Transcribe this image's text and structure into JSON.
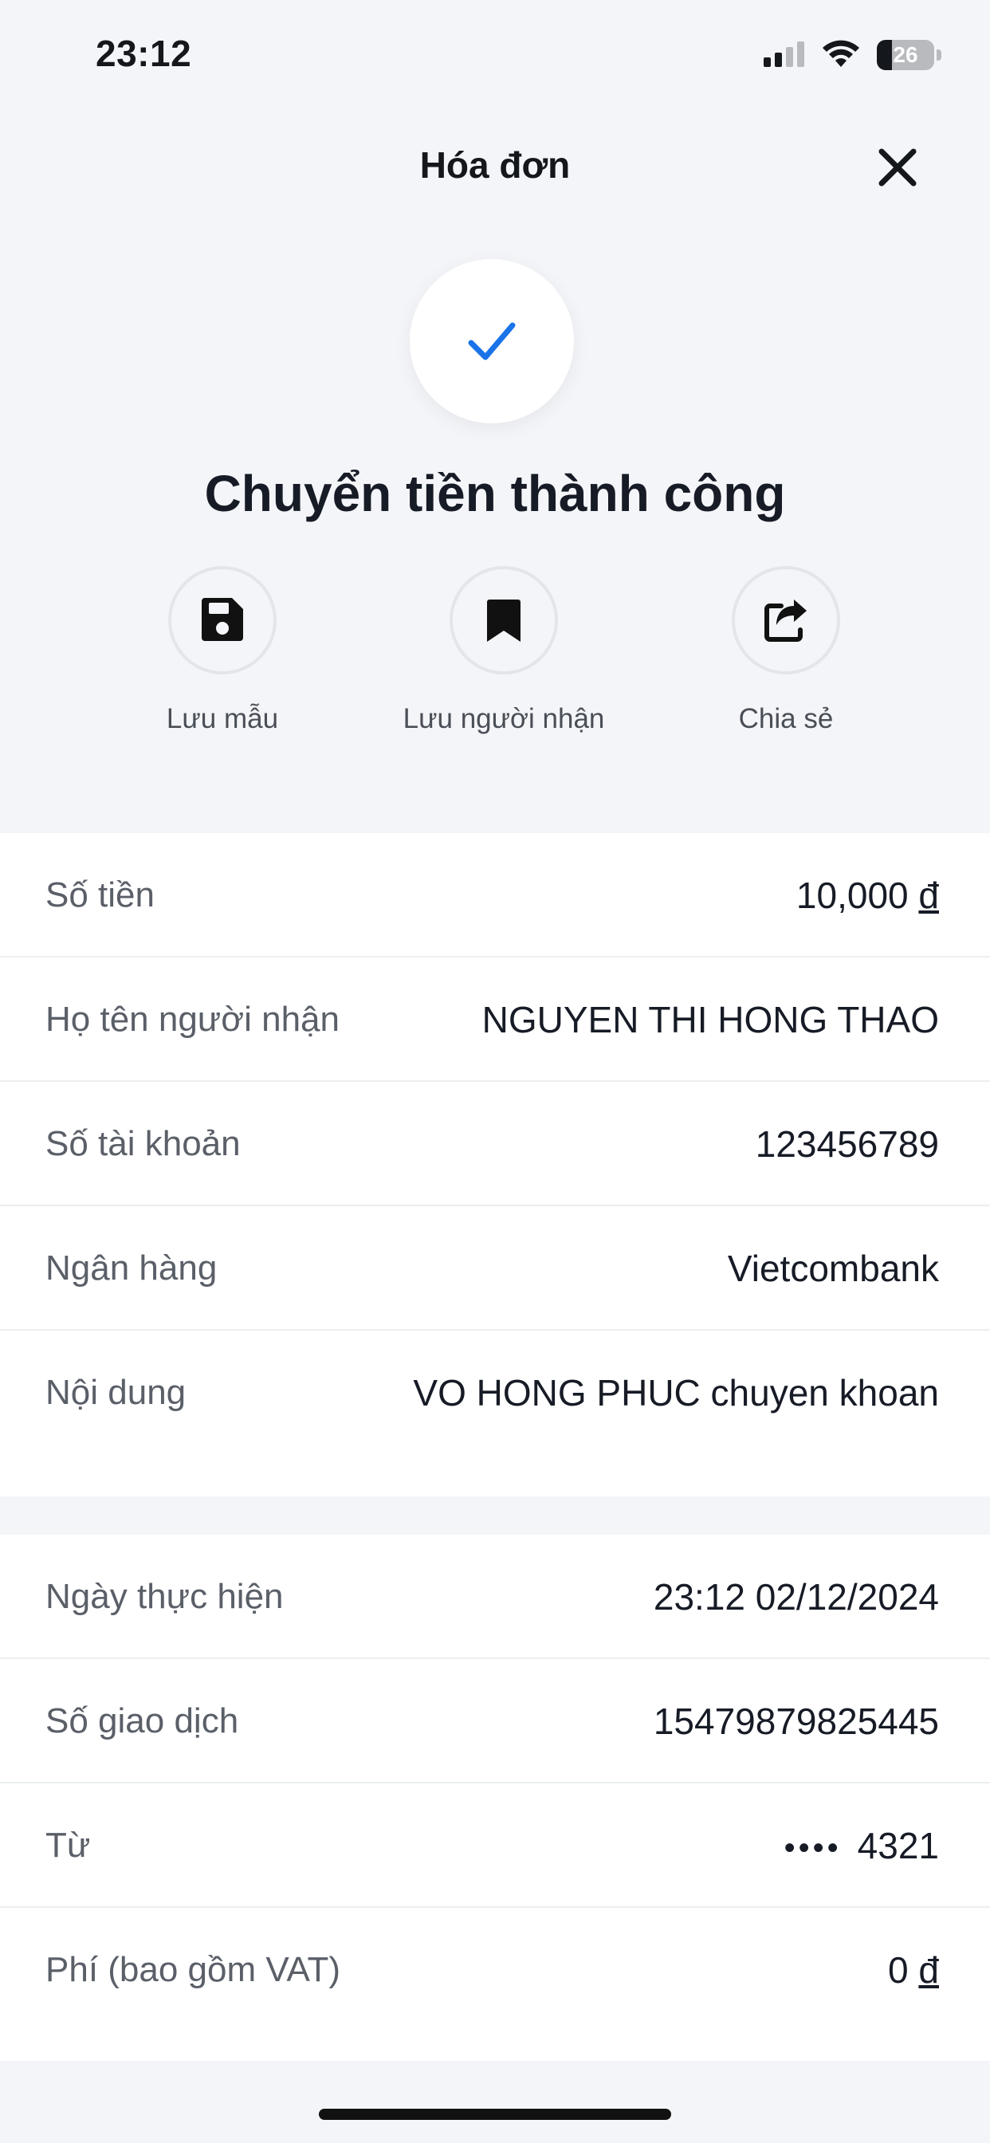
{
  "status_bar": {
    "time": "23:12",
    "battery_level": "26",
    "battery_fraction": 0.26,
    "icons": [
      "signal-icon",
      "wifi-icon",
      "battery-icon"
    ]
  },
  "header": {
    "title": "Hóa đơn",
    "close_icon": "close-icon"
  },
  "success": {
    "icon": "checkmark-icon",
    "title": "Chuyển tiền thành công",
    "accent_color": "#1a73e8"
  },
  "actions": [
    {
      "label": "Lưu mẫu",
      "icon": "floppy-disk-icon"
    },
    {
      "label": "Lưu người nhận",
      "icon": "bookmark-icon"
    },
    {
      "label": "Chia sẻ",
      "icon": "share-icon"
    }
  ],
  "transfer_details": [
    {
      "label": "Số tiền",
      "value": "10,000",
      "currency": "đ"
    },
    {
      "label": "Họ tên người nhận",
      "value": "NGUYEN THI HONG THAO"
    },
    {
      "label": "Số tài khoản",
      "value": "123456789"
    },
    {
      "label": "Ngân hàng",
      "value": "Vietcombank"
    },
    {
      "label": "Nội dung",
      "value": "VO HONG PHUC chuyen khoan"
    }
  ],
  "transaction_info": [
    {
      "label": "Ngày thực hiện",
      "value": "23:12 02/12/2024"
    },
    {
      "label": "Số giao dịch",
      "value": "15479879825445"
    },
    {
      "label": "Từ",
      "masked": "••••",
      "value": "4321"
    },
    {
      "label": "Phí (bao gồm VAT)",
      "value": "0",
      "currency": "đ"
    }
  ]
}
